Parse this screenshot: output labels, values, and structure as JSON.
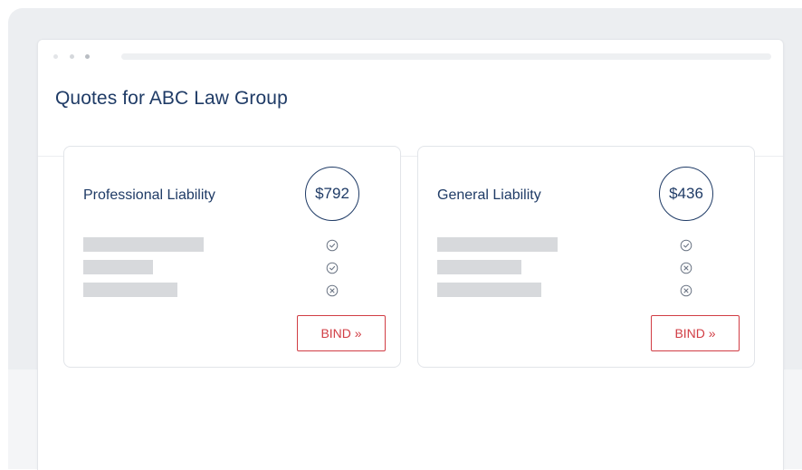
{
  "page": {
    "title": "Quotes for ABC Law Group"
  },
  "colors": {
    "primary_text": "#1f3b66",
    "accent": "#d13d44",
    "placeholder_bar": "#d7d9dc"
  },
  "quotes": [
    {
      "title": "Professional Liability",
      "price": "$792",
      "features": [
        {
          "status": "included",
          "icon": "check-circle-icon"
        },
        {
          "status": "included",
          "icon": "check-circle-icon"
        },
        {
          "status": "excluded",
          "icon": "x-circle-icon"
        }
      ],
      "bind_label": "BIND »"
    },
    {
      "title": "General Liability",
      "price": "$436",
      "features": [
        {
          "status": "included",
          "icon": "check-circle-icon"
        },
        {
          "status": "excluded",
          "icon": "x-circle-icon"
        },
        {
          "status": "excluded",
          "icon": "x-circle-icon"
        }
      ],
      "bind_label": "BIND »"
    }
  ]
}
